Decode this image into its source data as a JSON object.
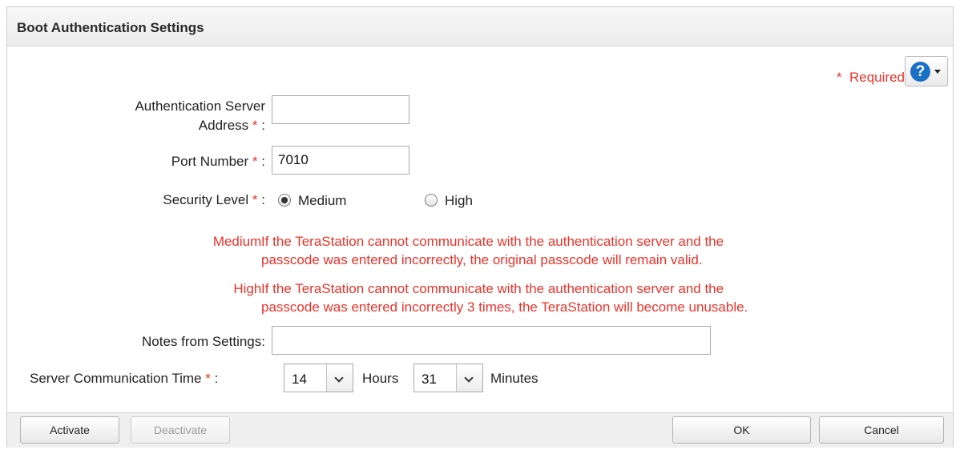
{
  "dialog": {
    "title": "Boot Authentication Settings",
    "required_label": "Required",
    "required_star": "*",
    "help_glyph": "?"
  },
  "form": {
    "auth_server_label_line1": "Authentication Server",
    "auth_server_label_line2": "Address",
    "auth_server_value": "",
    "port_label": "Port Number",
    "port_value": "7010",
    "security_label": "Security Level",
    "security_options": [
      "Medium",
      "High"
    ],
    "security_selected": "Medium",
    "medium_note_prefix": "Medium:",
    "medium_note_line1": "If the TeraStation cannot communicate with the authentication server and the",
    "medium_note_line2": "passcode was entered incorrectly, the original passcode will remain valid.",
    "high_note_prefix": "High:",
    "high_note_line1": "If the TeraStation cannot communicate with the authentication server and the",
    "high_note_line2": "passcode was entered incorrectly 3 times, the TeraStation will become unusable.",
    "notes_label": "Notes from Settings:",
    "notes_value": "",
    "comm_time_label": "Server Communication Time",
    "hours_value": "14",
    "hours_label": "Hours",
    "minutes_value": "31",
    "minutes_label": "Minutes",
    "star": "*",
    "colon": ":"
  },
  "footer": {
    "activate_label": "Activate",
    "deactivate_label": "Deactivate",
    "ok_label": "OK",
    "cancel_label": "Cancel"
  },
  "colors": {
    "required": "#e8332a",
    "help_icon": "#1c6fc7"
  }
}
